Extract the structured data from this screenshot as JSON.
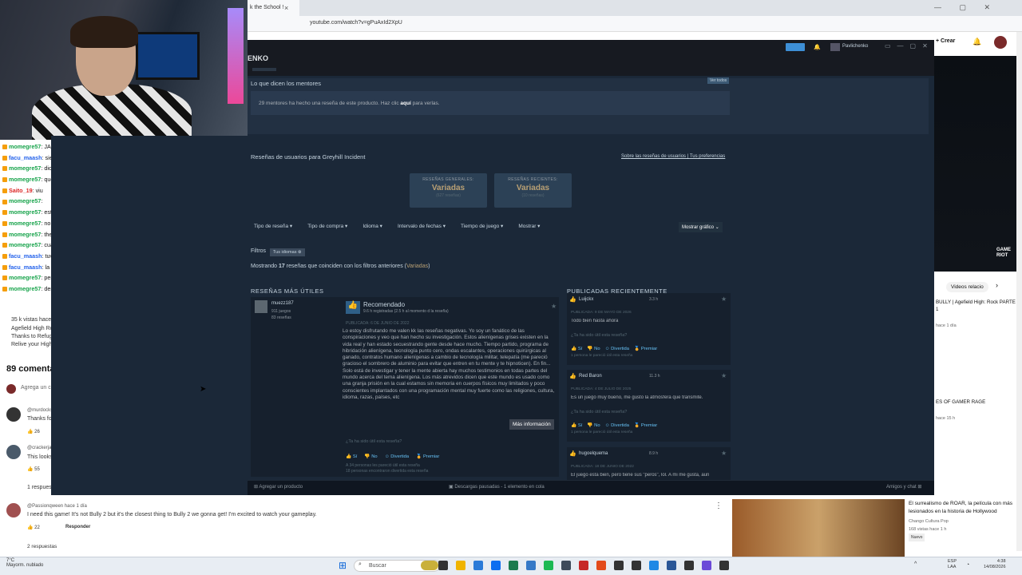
{
  "browser": {
    "tab_title": "k the School !",
    "tab_close": "×",
    "url": "youtube.com/watch?v=gPuAxId2XpU",
    "crear": "+ Crear"
  },
  "chat": {
    "lines": [
      {
        "user": "momegre57",
        "msg": ": JAJAJJA"
      },
      {
        "user": "facu_maash",
        "msg": ": siento asco"
      },
      {
        "user": "momegre57",
        "msg": ": dios las caras"
      },
      {
        "user": "momegre57",
        "msg": ": que incomodidad"
      },
      {
        "user": "Saito_19",
        "msg": ": viu"
      },
      {
        "user": "momegre57",
        "msg": ":"
      },
      {
        "user": "momegre57",
        "msg": ": esta vacio todo"
      },
      {
        "user": "momegre57",
        "msg": ": no hay nad"
      },
      {
        "user": "momegre57",
        "msg": ": the day before before"
      },
      {
        "user": "momegre57",
        "msg": ": cuanto se supone que tienen?"
      },
      {
        "user": "facu_maash",
        "msg": ": tuvieron una buena idea"
      },
      {
        "user": "facu_maash",
        "msg": ": la ejecucion deja mucho que desear"
      },
      {
        "user": "momegre57",
        "msg": ": pero MUUUCHO que desear"
      },
      {
        "user": "momegre57",
        "msg": ": demasiado"
      }
    ]
  },
  "youtube_left": {
    "views": "35 k vistas  hace",
    "desc1": "Agefield High Ro",
    "desc2": "Thanks to Refug",
    "desc3": "Relive your High",
    "comments_count": "89 comentar",
    "add_comment": "Agrega un c",
    "c1_user": "@murdocks",
    "c1_text": "Thanks fo",
    "c1_likes": "26",
    "c2_user": "@crackerja",
    "c2_text": "This looks",
    "c2_likes": "55",
    "c2_replies": "1 respues",
    "c3_user": "@Passionqween",
    "c3_time": "hace 1 día",
    "c3_text": "I need this game! It's not Bully 2 but it's the closest thing to Bully 2 we gonna get! I'm excited to watch your gameplay.",
    "c3_likes": "22",
    "c3_reply": "Responder",
    "c3_replies": "2 respuestas"
  },
  "steam": {
    "user": "Pavlichenko",
    "title": "ENKO",
    "mentors_title": "Lo que dicen los mentores",
    "view_all": "Ver todos",
    "mentors_text_a": "29 mentores ha hecho una reseña de este producto. Haz clic",
    "mentors_link": "aquí",
    "mentors_text_b": "para verlas.",
    "reviews_head": "Reseñas de usuarios para Greyhill Incident",
    "about_reviews": "Sobre las reseñas de usuarios",
    "your_prefs": "Tus preferencias",
    "summary_general_label": "RESEÑAS GENERALES:",
    "summary_general_value": "Variadas",
    "summary_general_count": "(627 reseñas)",
    "summary_recent_label": "RESEÑAS RECIENTES:",
    "summary_recent_value": "Variadas",
    "summary_recent_count": "(10 reseñas)",
    "filters": [
      "Tipo de reseña ▾",
      "Tipo de compra ▾",
      "Idioma ▾",
      "Intervalo de fechas ▾",
      "Tiempo de juego ▾",
      "Mostrar ▾"
    ],
    "show_graph": "Mostrar gráfico",
    "filters_label": "Filtros",
    "filter_chip": "Tus idiomas ⊗",
    "showing_a": "Mostrando",
    "showing_count": "17",
    "showing_b": "reseñas que coinciden con los filtros anteriores (",
    "showing_value": "Variadas",
    "showing_c": ")",
    "most_helpful": "RESEÑAS MÁS ÚTILES",
    "recently_posted": "PUBLICADAS RECIENTEMENTE",
    "rev1_user": "muezz187",
    "rev1_games": "911 juegos",
    "rev1_reviews": "83 reseñas",
    "rev1_rec": "Recomendado",
    "rev1_hours": "9.6 h registradas (2.5 h al momento d la reseña)",
    "rev1_date": "PUBLICADA: 6 DE JUNIO DE 2022",
    "rev1_body": "Lo estoy disfrutando me valen kk las reseñas negativas. Yo soy un fanático de las conspiraciones y veo que han hecho su investigación. Estos alienígenas grises existen en la vida real y han estado secuestrando gente desde hace mucho. Tiempo partido, programa de hibridación alienígena, tecnología punto cero, ondas escalantes, operaciones quirúrgicas al ganado, contratos humano alienígenas a cambio de tecnología militar, telepatía (me pareció gracioso el sombrero de aluminio para evitar que entren en tu mente y te hipnoticen). En fin... Solo está de investigar y tener la mente abierta hay muchos testimonios en todas partes del mundo acerca del tema alienígena. Los más atrevidos dicen que este mundo es usado como una granja prisión en la cual estamos sin memoria en cuerpos físicos muy limitados y poco conscientes implantados con una programación mental muy fuerte como las religiones, cultura, idioma, razas, países, etc",
    "more_info": "Más información",
    "helpful_q": "¿Ta ha sido útil esta reseña?",
    "vote_yes": "Sí",
    "vote_no": "No",
    "vote_funny": "Divertida",
    "vote_award": "Premiar",
    "rev1_helpful": "A 34 personas les pareció útil esta reseña",
    "rev1_funny": "18 personas encontraron divertida esta reseña",
    "recent": [
      {
        "user": "Luijckx",
        "hours": "3.3 h",
        "date": "PUBLICADA: 9 DE MAYO DE 2026",
        "text": "Todo bien hasta ahora",
        "helpful": "1 persona le pareció útil esta reseña"
      },
      {
        "user": "Red Baron",
        "hours": "11.3 h",
        "date": "PUBLICADA: 4 DE JULIO DE 2025",
        "text": "Es un juego muy bueno, me gusto la atmósfera que transmite.",
        "helpful": "1 persona le pareció útil esta reseña"
      },
      {
        "user": "hugoelquema",
        "hours": "8.9 h",
        "date": "PUBLICADA: 18 DE JUNIO DE 2022",
        "text": "El juego esta bien, pero tiene sus \"peros\", lol. A mi me gusta, aun",
        "helpful": ""
      }
    ],
    "add_product": "Agregar un producto",
    "downloads": "Descargas pausadas - 1 elemento en cola",
    "friends": "Amigos y chat"
  },
  "youtube_right": {
    "tab": "Videos relacio",
    "bully_title": "BULLY | Agefield High: Rock PARTE 1",
    "bully_age": "hace 1 día",
    "rage": "ES OF GAMER RAGE",
    "rage_age": "hace 15 h",
    "roar_title": "El surrealismo de ROAR, la película con más lesionados en la historia de Hollywood",
    "roar_channel": "Chango Cultura Pop",
    "roar_views": "168 vistas  hace 1 h",
    "roar_badge": "Nuevo"
  },
  "taskbar": {
    "weather_temp": "7°C",
    "weather_desc": "Mayorm. nublado",
    "search": "Buscar",
    "lang": "ESP",
    "lang2": "LAA",
    "time": "4:38",
    "date": "14/08/2026"
  }
}
